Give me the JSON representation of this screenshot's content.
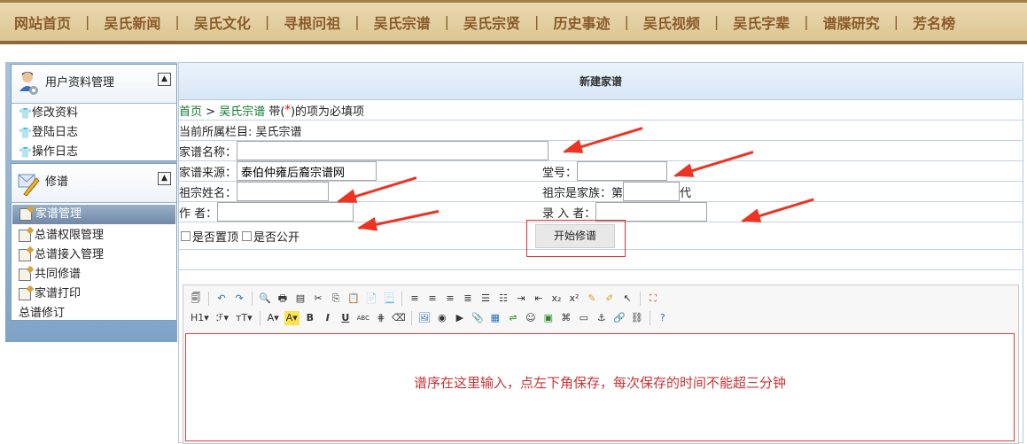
{
  "nav": [
    "网站首页",
    "吴氏新闻",
    "吴氏文化",
    "寻根问祖",
    "吴氏宗谱",
    "吴氏宗贤",
    "历史事迹",
    "吴氏视频",
    "吴氏字辈",
    "谱牒研究",
    "芳名榜"
  ],
  "sidebar": {
    "user_panel": {
      "title": "用户资料管理",
      "items": [
        "修改资料",
        "登陆日志",
        "操作日志"
      ]
    },
    "genealogy_panel": {
      "title": "修谱",
      "items": [
        "家谱管理",
        "总谱权限管理",
        "总谱接入管理",
        "共同修谱",
        "家谱打印",
        "总谱修订"
      ],
      "active": "家谱管理"
    }
  },
  "form": {
    "title": "新建家谱",
    "breadcrumb_home": "首页",
    "breadcrumb_sep": ">",
    "breadcrumb_section": "吴氏宗谱",
    "required_note_pre": "带(",
    "required_mark": "*",
    "required_note_post": ")的项为必填项",
    "current_column": "当前所属栏目: 吴氏宗谱",
    "name_label": "家谱名称：",
    "source_label": "家谱来源：",
    "source_value": "泰伯仲雍后裔宗谱网",
    "hall_label": "堂号：",
    "ancestor_label": "祖宗姓名：",
    "generation_label_pre": "祖宗是家族：第",
    "generation_label_post": "代",
    "author_label": "作 者：",
    "recorder_label": "录 入 者：",
    "pin_top_label": "是否置顶",
    "public_label": "是否公开",
    "start_button": "开始修谱"
  },
  "editor": {
    "hint": "谱序在这里输入，点左下角保存，每次保存的时间不能超三分钟",
    "toolbar_row2": [
      "H1",
      "ℱ",
      "тT",
      "A",
      "A",
      "B",
      "I",
      "U",
      "ABC"
    ]
  }
}
